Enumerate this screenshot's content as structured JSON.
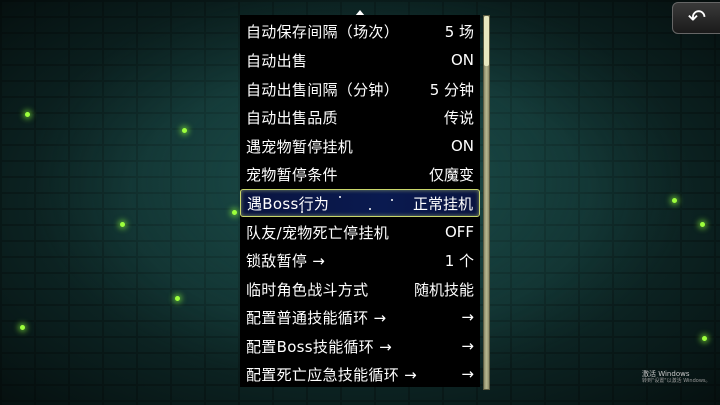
{
  "menu": {
    "rows": [
      {
        "label": "自动保存间隔（场次）",
        "value": "5 场"
      },
      {
        "label": "自动出售",
        "value": "ON"
      },
      {
        "label": "自动出售间隔（分钟）",
        "value": "5 分钟"
      },
      {
        "label": "自动出售品质",
        "value": "传说"
      },
      {
        "label": "遇宠物暂停挂机",
        "value": "ON"
      },
      {
        "label": "宠物暂停条件",
        "value": "仅魔变"
      },
      {
        "label": "遇Boss行为",
        "value": "正常挂机"
      },
      {
        "label": "队友/宠物死亡停挂机",
        "value": "OFF"
      },
      {
        "label": "锁敌暂停 →",
        "value": "1 个"
      },
      {
        "label": "临时角色战斗方式",
        "value": "随机技能"
      },
      {
        "label": "配置普通技能循环 →",
        "value": "→"
      },
      {
        "label": "配置Boss技能循环 →",
        "value": "→"
      },
      {
        "label": "配置死亡应急技能循环 →",
        "value": "→"
      }
    ],
    "selected_row": "遇Boss行为"
  },
  "back_button": {
    "icon": "undo-arrow-icon",
    "glyph": "↶"
  },
  "watermark": {
    "line1": "激活 Windows",
    "line2": "转到\"设置\"以激活 Windows。"
  },
  "colors": {
    "accent_border": "#c9d66a",
    "selected_bg": "#0a1440",
    "spark": "#9dff3c"
  }
}
